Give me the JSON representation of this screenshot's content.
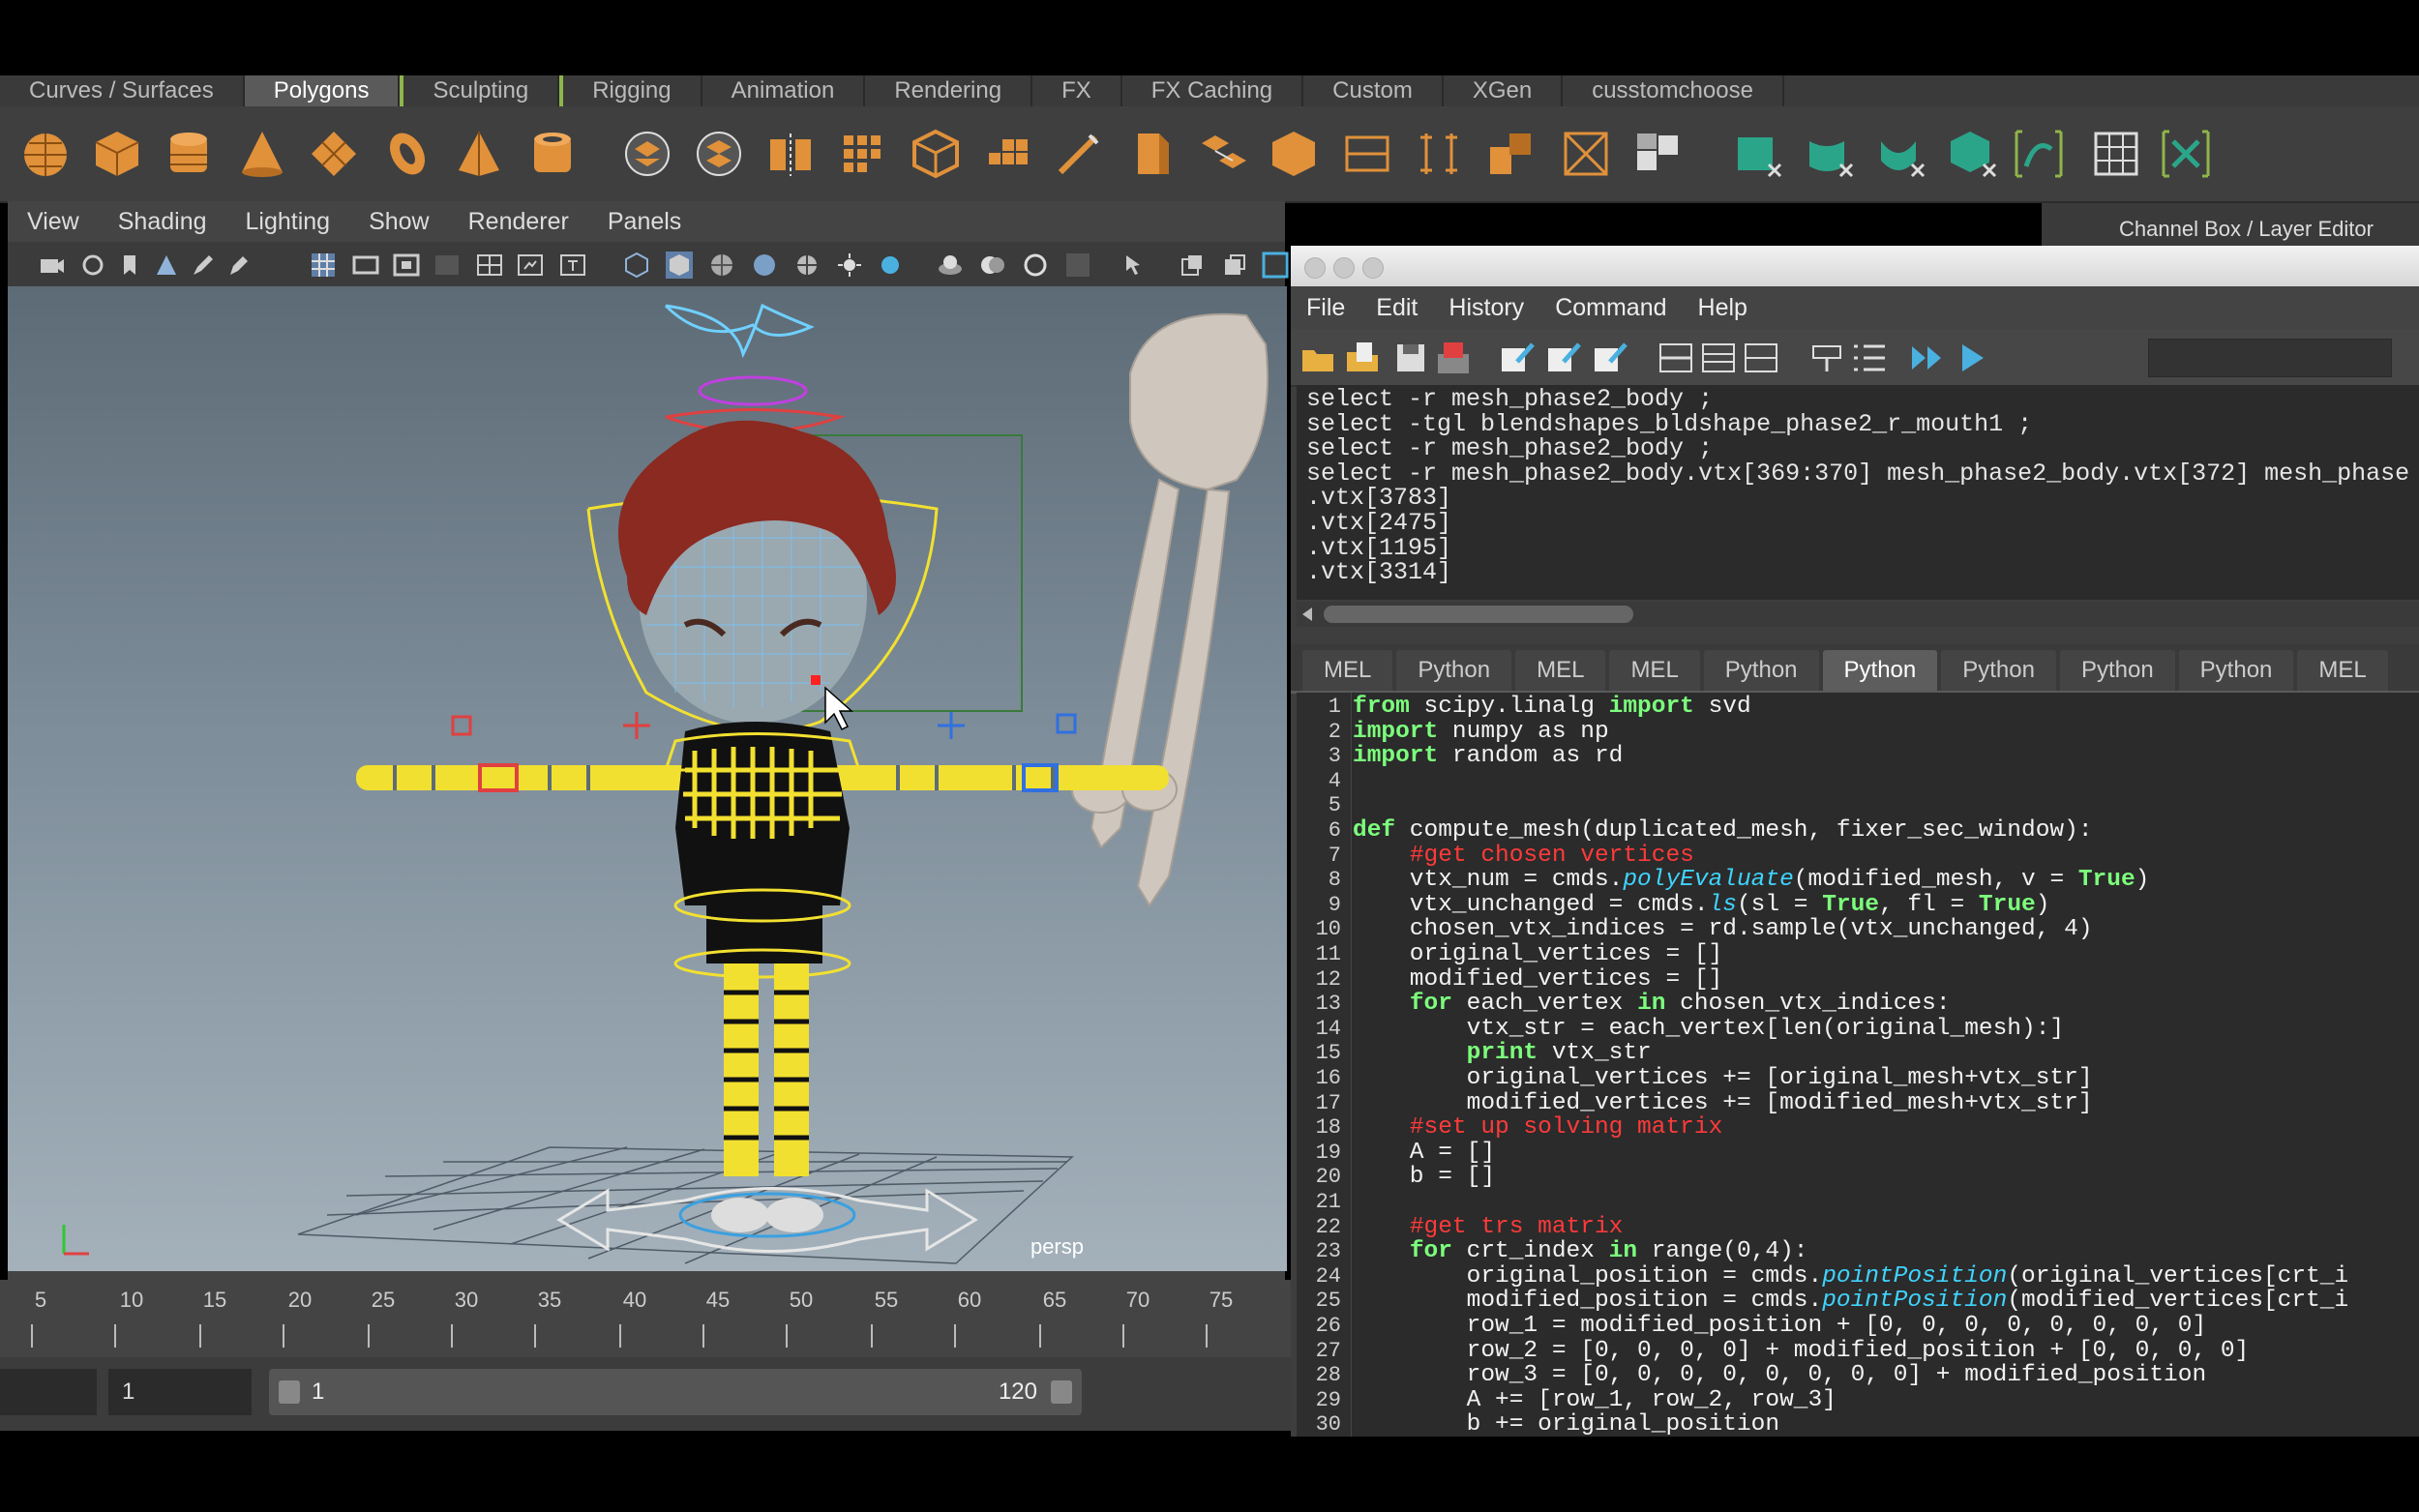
{
  "shelf_tabs": [
    "Curves / Surfaces",
    "Polygons",
    "Sculpting",
    "Rigging",
    "Animation",
    "Rendering",
    "FX",
    "FX Caching",
    "Custom",
    "XGen",
    "cusstomchoose"
  ],
  "shelf_active": "Polygons",
  "viewport_menu": [
    "View",
    "Shading",
    "Lighting",
    "Show",
    "Renderer",
    "Panels"
  ],
  "viewport_label": "persp",
  "timeline_ticks": [
    "5",
    "10",
    "15",
    "20",
    "25",
    "30",
    "35",
    "40",
    "45",
    "50",
    "55",
    "60",
    "65",
    "70",
    "75"
  ],
  "range": {
    "current_frame": "1",
    "start": "1",
    "end": "120"
  },
  "channel_box_title": "Channel Box / Layer Editor",
  "script_editor": {
    "menus": [
      "File",
      "Edit",
      "History",
      "Command",
      "Help"
    ],
    "history": "select -r mesh_phase2_body ;\nselect -tgl blendshapes_bldshape_phase2_r_mouth1 ;\nselect -r mesh_phase2_body ;\nselect -r mesh_phase2_body.vtx[369:370] mesh_phase2_body.vtx[372] mesh_phase\n.vtx[3783]\n.vtx[2475]\n.vtx[1195]\n.vtx[3314]",
    "tabs": [
      "MEL",
      "Python",
      "MEL",
      "MEL",
      "Python",
      "Python",
      "Python",
      "Python",
      "Python",
      "MEL"
    ],
    "active_tab_index": 5,
    "code_lines": [
      "1",
      "2",
      "3",
      "4",
      "5",
      "6",
      "7",
      "8",
      "9",
      "10",
      "11",
      "12",
      "13",
      "14",
      "15",
      "16",
      "17",
      "18",
      "19",
      "20",
      "21",
      "22",
      "23",
      "24",
      "25",
      "26",
      "27",
      "28",
      "29",
      "30"
    ]
  },
  "colors": {
    "keyword": "#7cff7c",
    "function": "#3fd4ff",
    "comment": "#ff3a3a",
    "shelf_icon": "#e0913a",
    "accent": "#8fb54a"
  }
}
